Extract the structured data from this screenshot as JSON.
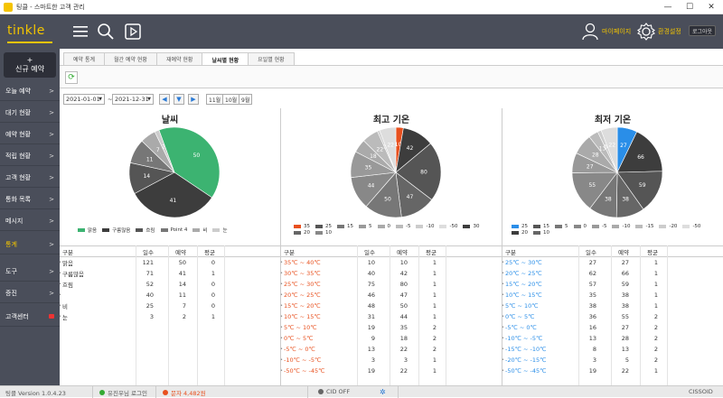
{
  "window": {
    "title": "팅클 - 스마트한 고객 관리",
    "minimize": "—",
    "maximize": "☐",
    "close": "✕"
  },
  "header": {
    "logo": "tinkle",
    "mypage": "마이페이지",
    "settings": "환경설정",
    "logout": "로그아웃"
  },
  "sidebar": {
    "new_reservation": "+\n신규 예약",
    "items": [
      {
        "label": "오늘 예약",
        "chevron": ">"
      },
      {
        "label": "대기 현황",
        "chevron": ">"
      },
      {
        "label": "예약 현황",
        "chevron": ">"
      },
      {
        "label": "적립 현황",
        "chevron": ">"
      },
      {
        "label": "고객 현황",
        "chevron": ">"
      },
      {
        "label": "통화 목록",
        "chevron": ">"
      },
      {
        "label": "메시지",
        "chevron": ">"
      },
      {
        "label": "통계",
        "chevron": ">"
      },
      {
        "label": "도구",
        "chevron": ">"
      },
      {
        "label": "증진",
        "chevron": ">"
      },
      {
        "label": "고객센터",
        "chevron": ""
      }
    ]
  },
  "tabs": [
    "예약 통계",
    "월간 예약 현황",
    "재예약 현황",
    "날씨별 현황",
    "요일별 현황"
  ],
  "active_tab": 3,
  "filters": {
    "start_date": "2021-01-01",
    "tilde": "~",
    "end_date": "2021-12-31",
    "months": [
      "11월",
      "10월",
      "9월"
    ]
  },
  "colors": {
    "header": "#4a4e5a",
    "accent": "#f2c400",
    "green": "#3cb371",
    "orange": "#e8501e",
    "blue": "#2a8ee8"
  },
  "status": {
    "version": "팅클 Version 1.0.4.23",
    "user": "유진우님 로그인",
    "sms": "문자 4,482원",
    "cid": "CID OFF",
    "right": "CISSOID"
  },
  "panels": [
    {
      "title": "날씨",
      "columns": [
        "구분",
        "일수",
        "예약",
        "평균"
      ],
      "rows": [
        [
          "맑음",
          "121",
          "50",
          "0"
        ],
        [
          "구름많음",
          "71",
          "41",
          "1"
        ],
        [
          "흐림",
          "52",
          "14",
          "0"
        ],
        [
          "",
          "40",
          "11",
          "0"
        ],
        [
          "비",
          "25",
          "7",
          "0"
        ],
        [
          "눈",
          "3",
          "2",
          "1"
        ]
      ]
    },
    {
      "title": "최고 기온",
      "columns": [
        "구분",
        "일수",
        "예약",
        "평균"
      ],
      "rows": [
        [
          "35℃ ~ 40℃",
          "10",
          "10",
          "1"
        ],
        [
          "30℃ ~ 35℃",
          "40",
          "42",
          "1"
        ],
        [
          "25℃ ~ 30℃",
          "75",
          "80",
          "1"
        ],
        [
          "20℃ ~ 25℃",
          "46",
          "47",
          "1"
        ],
        [
          "15℃ ~ 20℃",
          "48",
          "50",
          "1"
        ],
        [
          "10℃ ~ 15℃",
          "31",
          "44",
          "1"
        ],
        [
          "5℃ ~ 10℃",
          "19",
          "35",
          "2"
        ],
        [
          "0℃ ~ 5℃",
          "9",
          "18",
          "2"
        ],
        [
          "-5℃ ~ 0℃",
          "13",
          "22",
          "2"
        ],
        [
          "-10℃ ~ -5℃",
          "3",
          "3",
          "1"
        ],
        [
          "-50℃ ~ -45℃",
          "19",
          "22",
          "1"
        ]
      ]
    },
    {
      "title": "최저 기온",
      "columns": [
        "구분",
        "일수",
        "예약",
        "평균"
      ],
      "rows": [
        [
          "25℃ ~ 30℃",
          "27",
          "27",
          "1"
        ],
        [
          "20℃ ~ 25℃",
          "62",
          "66",
          "1"
        ],
        [
          "15℃ ~ 20℃",
          "57",
          "59",
          "1"
        ],
        [
          "10℃ ~ 15℃",
          "35",
          "38",
          "1"
        ],
        [
          "5℃ ~ 10℃",
          "38",
          "38",
          "1"
        ],
        [
          "0℃ ~ 5℃",
          "36",
          "55",
          "2"
        ],
        [
          "-5℃ ~ 0℃",
          "16",
          "27",
          "2"
        ],
        [
          "-10℃ ~ -5℃",
          "13",
          "28",
          "2"
        ],
        [
          "-15℃ ~ -10℃",
          "8",
          "13",
          "2"
        ],
        [
          "-20℃ ~ -15℃",
          "3",
          "5",
          "2"
        ],
        [
          "-50℃ ~ -45℃",
          "19",
          "22",
          "1"
        ]
      ]
    }
  ],
  "chart_data": [
    {
      "type": "pie",
      "title": "날씨",
      "slices": [
        {
          "label": "맑음",
          "value": 50,
          "color": "#3cb371"
        },
        {
          "label": "구름많음",
          "value": 41,
          "color": "#3d3d3d"
        },
        {
          "label": "흐림",
          "value": 14,
          "color": "#555555"
        },
        {
          "label": "Point 4",
          "value": 11,
          "color": "#777777"
        },
        {
          "label": "비",
          "value": 7,
          "color": "#aaaaaa"
        },
        {
          "label": "눈",
          "value": 2,
          "color": "#cccccc"
        }
      ],
      "legend": [
        "맑음",
        "구름많음",
        "흐림",
        "Point 4",
        "비",
        "눈"
      ]
    },
    {
      "type": "pie",
      "title": "최고 기온",
      "slices": [
        {
          "label": "35",
          "value": 10,
          "color": "#e8501e"
        },
        {
          "label": "30",
          "value": 42,
          "color": "#3d3d3d"
        },
        {
          "label": "25",
          "value": 80,
          "color": "#555555"
        },
        {
          "label": "20",
          "value": 47,
          "color": "#666666"
        },
        {
          "label": "15",
          "value": 50,
          "color": "#777777"
        },
        {
          "label": "10",
          "value": 44,
          "color": "#888888"
        },
        {
          "label": "5",
          "value": 35,
          "color": "#999999"
        },
        {
          "label": "0",
          "value": 18,
          "color": "#aaaaaa"
        },
        {
          "label": "-5",
          "value": 22,
          "color": "#bbbbbb"
        },
        {
          "label": "-10",
          "value": 3,
          "color": "#cccccc"
        },
        {
          "label": "-50",
          "value": 22,
          "color": "#dddddd"
        }
      ],
      "legend": [
        "35",
        "25",
        "15",
        "5",
        "0",
        "-5",
        "-10",
        "-50",
        "30",
        "20",
        "10"
      ]
    },
    {
      "type": "pie",
      "title": "최저 기온",
      "slices": [
        {
          "label": "25",
          "value": 27,
          "color": "#2a8ee8"
        },
        {
          "label": "20",
          "value": 66,
          "color": "#3d3d3d"
        },
        {
          "label": "15",
          "value": 59,
          "color": "#555555"
        },
        {
          "label": "10",
          "value": 38,
          "color": "#666666"
        },
        {
          "label": "5",
          "value": 38,
          "color": "#777777"
        },
        {
          "label": "0",
          "value": 55,
          "color": "#888888"
        },
        {
          "label": "-5",
          "value": 27,
          "color": "#999999"
        },
        {
          "label": "-10",
          "value": 28,
          "color": "#aaaaaa"
        },
        {
          "label": "-15",
          "value": 13,
          "color": "#bbbbbb"
        },
        {
          "label": "-20",
          "value": 5,
          "color": "#cccccc"
        },
        {
          "label": "-50",
          "value": 22,
          "color": "#dddddd"
        }
      ],
      "legend": [
        "25",
        "15",
        "5",
        "0",
        "-5",
        "-10",
        "-15",
        "-20",
        "-50",
        "20",
        "10"
      ]
    }
  ]
}
